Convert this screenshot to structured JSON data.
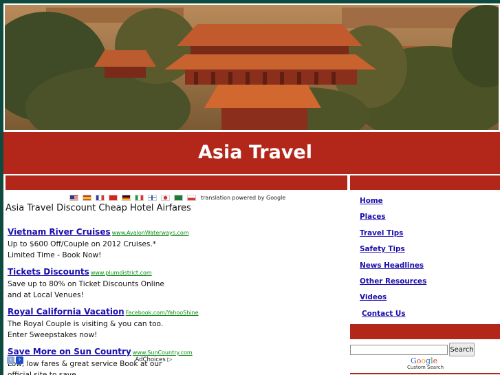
{
  "site": {
    "title": "Asia Travel"
  },
  "translation": {
    "note": "translation powered by Google",
    "flags": [
      "us-flag",
      "es-flag",
      "fr-flag",
      "cn-flag",
      "de-flag",
      "it-flag",
      "fi-flag",
      "jp-flag",
      "sa-flag",
      "pl-flag"
    ]
  },
  "main": {
    "heading": "Asia Travel Discount Cheap Hotel Airfares"
  },
  "ads": [
    {
      "title": "Vietnam River Cruises",
      "url": "www.AvalonWaterways.com",
      "desc": "Up to $600 Off/Couple on 2012 Cruises.* Limited Time - Book Now!"
    },
    {
      "title": "Tickets Discounts",
      "url": "www.plumdistrict.com",
      "desc": "Save up to 80% on Ticket Discounts Online and at Local Venues!"
    },
    {
      "title": "Royal California Vacation",
      "url": "Facebook.com/YahooShine",
      "desc": "The Royal Couple is visiting & you can too. Enter Sweepstakes now!"
    },
    {
      "title": "Save More on Sun Country",
      "url": "www.SunCountry.com",
      "desc": "Low, low fares & great service Book at our official site to save"
    }
  ],
  "ad_footer": {
    "prev": "‹",
    "next": "›",
    "choices": "AdChoices"
  },
  "nav": [
    "Home",
    "Places",
    "Travel Tips",
    "Safety Tips",
    "News Headlines",
    "Other Resources",
    "Videos",
    "Contact Us"
  ],
  "search": {
    "button": "Search",
    "value": "",
    "caption": "Custom Search"
  },
  "colors": {
    "accent": "#b3271b",
    "page_bg": "#0f4a3e",
    "link": "#1a0dab",
    "ad_url": "#0a8a16"
  }
}
